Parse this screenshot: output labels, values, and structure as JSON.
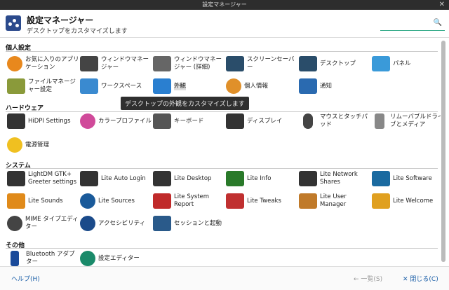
{
  "window": {
    "title": "設定マネージャー",
    "close_glyph": "✕"
  },
  "header": {
    "title": "設定マネージャー",
    "subtitle": "デスクトップをカスタマイズします",
    "search_placeholder": "",
    "search_glyph": "🔍"
  },
  "sections": [
    {
      "title": "個人設定",
      "items": [
        {
          "label": "お気に入りのアプリケーション",
          "icon": "star-icon",
          "color": "#e8881d"
        },
        {
          "label": "ウィンドウマネージャー",
          "icon": "window-manager-icon",
          "color": "#444"
        },
        {
          "label": "ウィンドウマネージャー (詳細)",
          "icon": "window-manager-advanced-icon",
          "color": "#666"
        },
        {
          "label": "スクリーンセーバー",
          "icon": "screensaver-icon",
          "color": "#2a4d6a"
        },
        {
          "label": "デスクトップ",
          "icon": "desktop-icon",
          "color": "#2a4d6a"
        },
        {
          "label": "パネル",
          "icon": "panel-icon",
          "color": "#3a9ad9"
        },
        {
          "label": "ファイルマネージャー設定",
          "icon": "file-manager-icon",
          "color": "#8a9a3a"
        },
        {
          "label": "ワークスペース",
          "icon": "workspace-icon",
          "color": "#3a8ad0"
        },
        {
          "label": "外観",
          "icon": "appearance-icon",
          "color": "#2a7fd0"
        },
        {
          "label": "個人情報",
          "icon": "user-icon",
          "color": "#e0902a"
        },
        {
          "label": "通知",
          "icon": "notification-icon",
          "color": "#2a6ab0"
        }
      ]
    },
    {
      "title": "ハードウェア",
      "items": [
        {
          "label": "HiDPI Settings",
          "icon": "hidpi-icon",
          "color": "#333"
        },
        {
          "label": "カラープロファイル",
          "icon": "color-profile-icon",
          "color": "#d04a9a"
        },
        {
          "label": "キーボード",
          "icon": "keyboard-icon",
          "color": "#555"
        },
        {
          "label": "ディスプレイ",
          "icon": "display-icon",
          "color": "#333"
        },
        {
          "label": "マウスとタッチパッド",
          "icon": "mouse-icon",
          "color": "#444"
        },
        {
          "label": "リムーバブルドライブとメディア",
          "icon": "eject-icon",
          "color": "#888"
        },
        {
          "label": "電源管理",
          "icon": "power-icon",
          "color": "#f0c020"
        }
      ]
    },
    {
      "title": "システム",
      "items": [
        {
          "label": "LightDM GTK+ Greeter settings",
          "icon": "lightdm-icon",
          "color": "#333"
        },
        {
          "label": "Lite Auto Login",
          "icon": "lock-icon",
          "color": "#333"
        },
        {
          "label": "Lite Desktop",
          "icon": "lite-desktop-icon",
          "color": "#333"
        },
        {
          "label": "Lite Info",
          "icon": "info-icon",
          "color": "#2a7a2a"
        },
        {
          "label": "Lite Network Shares",
          "icon": "network-shares-icon",
          "color": "#333"
        },
        {
          "label": "Lite Software",
          "icon": "software-icon",
          "color": "#1a6aa0"
        },
        {
          "label": "Lite Sounds",
          "icon": "sounds-icon",
          "color": "#e08a1a"
        },
        {
          "label": "Lite Sources",
          "icon": "sources-icon",
          "color": "#1a5a9a"
        },
        {
          "label": "Lite System Report",
          "icon": "system-report-icon",
          "color": "#c02a2a"
        },
        {
          "label": "Lite Tweaks",
          "icon": "tweaks-icon",
          "color": "#c03030"
        },
        {
          "label": "Lite User Manager",
          "icon": "user-manager-icon",
          "color": "#c07a2a"
        },
        {
          "label": "Lite Welcome",
          "icon": "welcome-icon",
          "color": "#e0a020"
        },
        {
          "label": "MIME タイプエディター",
          "icon": "gear-icon",
          "color": "#444"
        },
        {
          "label": "アクセシビリティ",
          "icon": "accessibility-icon",
          "color": "#1a4a8a"
        },
        {
          "label": "セッションと起動",
          "icon": "session-icon",
          "color": "#2a5a8a"
        }
      ]
    },
    {
      "title": "その他",
      "items": [
        {
          "label": "Bluetooth アダプター",
          "icon": "bluetooth-icon",
          "color": "#1a4a9a"
        },
        {
          "label": "設定エディター",
          "icon": "settings-editor-icon",
          "color": "#1a8a6a"
        }
      ]
    }
  ],
  "tooltip": "デスクトップの外観をカスタマイズします",
  "footer": {
    "help": "ヘルプ(H)",
    "back": "← 一覧(S)",
    "close": "✕ 閉じる(C)"
  }
}
